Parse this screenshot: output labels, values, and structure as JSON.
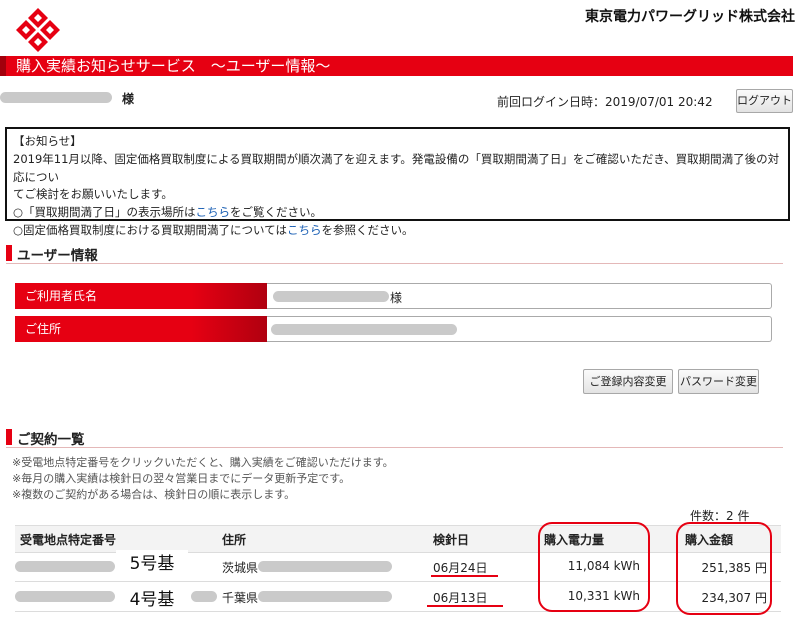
{
  "header": {
    "company": "東京電力パワーグリッド株式会社",
    "service_title": "購入実績お知らせサービス　～ユーザー情報～"
  },
  "user": {
    "suffix": "様",
    "last_login_label": "前回ログイン日時：",
    "last_login_value": "2019/07/01 20:42",
    "logout_label": "ログアウト"
  },
  "notice": {
    "heading": "【お知らせ】",
    "line1": "2019年11月以降、固定価格買取制度による買取期間が順次満了を迎えます。発電設備の「買取期間満了日」をご確認いただき、買取期間満了後の対応につい",
    "line2": "てご検討をお願いいたします。",
    "line3_pre": "○「買取期間満了日」の表示場所は",
    "line3_link": "こちら",
    "line3_post": "をご覧ください。",
    "line4_pre": "○固定価格買取制度における買取期間満了については",
    "line4_link": "こちら",
    "line4_post": "を参照ください。"
  },
  "user_info": {
    "section_title": "ユーザー情報",
    "name_label": "ご利用者氏名",
    "name_suffix": "様",
    "address_label": "ご住所",
    "edit_button": "ご登録内容変更",
    "password_button": "パスワード変更"
  },
  "contracts": {
    "section_title": "ご契約一覧",
    "notes": [
      "※受電地点特定番号をクリックいただくと、購入実績をご確認いただけます。",
      "※毎月の購入実績は検針日の翌々営業日までにデータ更新予定です。",
      "※複数のご契約がある場合は、検針日の順に表示します。"
    ],
    "count_label": "件数：2 件",
    "columns": [
      "受電地点特定番号",
      "住所",
      "検針日",
      "購入電力量",
      "購入金額"
    ],
    "rows": [
      {
        "unit_label": "5号基",
        "prefecture": "茨城県",
        "meter_date": "06月24日",
        "energy": "11,084 kWh",
        "amount": "251,385 円"
      },
      {
        "unit_label": "4号基",
        "prefecture": "千葉県",
        "meter_date": "06月13日",
        "energy": "10,331 kWh",
        "amount": "234,307 円"
      }
    ]
  },
  "colors": {
    "accent": "#e60012",
    "link": "#1a5fb4"
  }
}
